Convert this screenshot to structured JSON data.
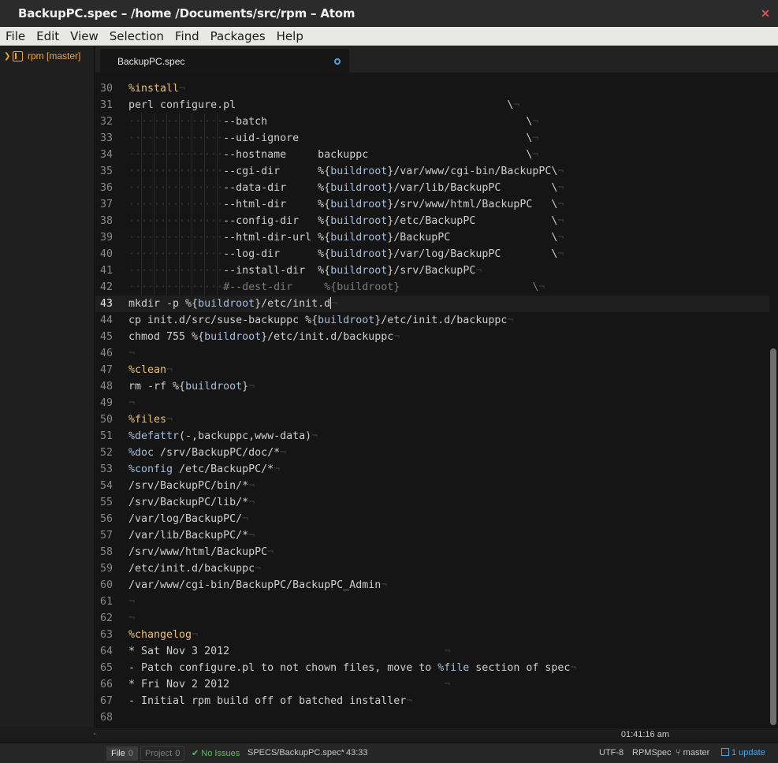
{
  "window": {
    "title": "BackupPC.spec – /home /Documents/src/rpm – Atom"
  },
  "menu": [
    "File",
    "Edit",
    "View",
    "Selection",
    "Find",
    "Packages",
    "Help"
  ],
  "tree": {
    "project_label": "rpm  [master]"
  },
  "tab": {
    "title": "BackupPC.spec"
  },
  "editor": {
    "cursor_line": 43,
    "lines": [
      {
        "n": "30",
        "tokens": [
          [
            "kw",
            "%install"
          ],
          [
            "eol",
            "¬"
          ]
        ]
      },
      {
        "n": "31",
        "tokens": [
          [
            "plain",
            "perl configure.pl                                           \\"
          ],
          [
            "eol",
            "¬"
          ]
        ]
      },
      {
        "n": "32",
        "tokens": [
          [
            "ws",
            "···············"
          ],
          [
            "plain",
            "--batch                                         \\"
          ],
          [
            "eol",
            "¬"
          ]
        ]
      },
      {
        "n": "33",
        "tokens": [
          [
            "ws",
            "···············"
          ],
          [
            "plain",
            "--uid-ignore                                    \\"
          ],
          [
            "eol",
            "¬"
          ]
        ]
      },
      {
        "n": "34",
        "tokens": [
          [
            "ws",
            "···············"
          ],
          [
            "plain",
            "--hostname     backuppc                         \\"
          ],
          [
            "eol",
            "¬"
          ]
        ]
      },
      {
        "n": "35",
        "tokens": [
          [
            "ws",
            "···············"
          ],
          [
            "plain",
            "--cgi-dir      %{"
          ],
          [
            "var",
            "buildroot"
          ],
          [
            "plain",
            "}/var/www/cgi-bin/BackupPC\\"
          ],
          [
            "eol",
            "¬"
          ]
        ]
      },
      {
        "n": "36",
        "tokens": [
          [
            "ws",
            "···············"
          ],
          [
            "plain",
            "--data-dir     %{"
          ],
          [
            "var",
            "buildroot"
          ],
          [
            "plain",
            "}/var/lib/BackupPC        \\"
          ],
          [
            "eol",
            "¬"
          ]
        ]
      },
      {
        "n": "37",
        "tokens": [
          [
            "ws",
            "···············"
          ],
          [
            "plain",
            "--html-dir     %{"
          ],
          [
            "var",
            "buildroot"
          ],
          [
            "plain",
            "}/srv/www/html/BackupPC   \\"
          ],
          [
            "eol",
            "¬"
          ]
        ]
      },
      {
        "n": "38",
        "tokens": [
          [
            "ws",
            "···············"
          ],
          [
            "plain",
            "--config-dir   %{"
          ],
          [
            "var",
            "buildroot"
          ],
          [
            "plain",
            "}/etc/BackupPC            \\"
          ],
          [
            "eol",
            "¬"
          ]
        ]
      },
      {
        "n": "39",
        "tokens": [
          [
            "ws",
            "···············"
          ],
          [
            "plain",
            "--html-dir-url %{"
          ],
          [
            "var",
            "buildroot"
          ],
          [
            "plain",
            "}/BackupPC                \\"
          ],
          [
            "eol",
            "¬"
          ]
        ]
      },
      {
        "n": "40",
        "tokens": [
          [
            "ws",
            "···············"
          ],
          [
            "plain",
            "--log-dir      %{"
          ],
          [
            "var",
            "buildroot"
          ],
          [
            "plain",
            "}/var/log/BackupPC        \\"
          ],
          [
            "eol",
            "¬"
          ]
        ]
      },
      {
        "n": "41",
        "tokens": [
          [
            "ws",
            "···············"
          ],
          [
            "plain",
            "--install-dir  %{"
          ],
          [
            "var",
            "buildroot"
          ],
          [
            "plain",
            "}/srv/BackupPC"
          ],
          [
            "eol",
            "¬"
          ]
        ]
      },
      {
        "n": "42",
        "tokens": [
          [
            "ws",
            "···············"
          ],
          [
            "com",
            "#--dest-dir     %{buildroot}                     \\"
          ],
          [
            "eol",
            "¬"
          ]
        ]
      },
      {
        "n": "43",
        "tokens": [
          [
            "plain",
            "mkdir -p %{"
          ],
          [
            "var",
            "buildroot"
          ],
          [
            "plain",
            "}/etc/init.d"
          ],
          [
            "cursor",
            ""
          ],
          [
            "eol",
            "¬"
          ]
        ]
      },
      {
        "n": "44",
        "tokens": [
          [
            "plain",
            "cp init.d/src/suse-backuppc %{"
          ],
          [
            "var",
            "buildroot"
          ],
          [
            "plain",
            "}/etc/init.d/backuppc"
          ],
          [
            "eol",
            "¬"
          ]
        ]
      },
      {
        "n": "45",
        "tokens": [
          [
            "plain",
            "chmod 755 %{"
          ],
          [
            "var",
            "buildroot"
          ],
          [
            "plain",
            "}/etc/init.d/backuppc"
          ],
          [
            "eol",
            "¬"
          ]
        ]
      },
      {
        "n": "46",
        "tokens": [
          [
            "eol",
            "¬"
          ]
        ]
      },
      {
        "n": "47",
        "tokens": [
          [
            "kw",
            "%clean"
          ],
          [
            "eol",
            "¬"
          ]
        ]
      },
      {
        "n": "48",
        "tokens": [
          [
            "plain",
            "rm -rf %{"
          ],
          [
            "var",
            "buildroot"
          ],
          [
            "plain",
            "}"
          ],
          [
            "eol",
            "¬"
          ]
        ]
      },
      {
        "n": "49",
        "tokens": [
          [
            "eol",
            "¬"
          ]
        ]
      },
      {
        "n": "50",
        "tokens": [
          [
            "kw",
            "%files"
          ],
          [
            "eol",
            "¬"
          ]
        ]
      },
      {
        "n": "51",
        "tokens": [
          [
            "var",
            "%defattr"
          ],
          [
            "plain",
            "(-,backuppc,www-data)"
          ],
          [
            "eol",
            "¬"
          ]
        ]
      },
      {
        "n": "52",
        "tokens": [
          [
            "var",
            "%doc"
          ],
          [
            "plain",
            " /srv/BackupPC/doc/*"
          ],
          [
            "eol",
            "¬"
          ]
        ]
      },
      {
        "n": "53",
        "tokens": [
          [
            "var",
            "%config"
          ],
          [
            "plain",
            " /etc/BackupPC/*"
          ],
          [
            "eol",
            "¬"
          ]
        ]
      },
      {
        "n": "54",
        "tokens": [
          [
            "plain",
            "/srv/BackupPC/bin/*"
          ],
          [
            "eol",
            "¬"
          ]
        ]
      },
      {
        "n": "55",
        "tokens": [
          [
            "plain",
            "/srv/BackupPC/lib/*"
          ],
          [
            "eol",
            "¬"
          ]
        ]
      },
      {
        "n": "56",
        "tokens": [
          [
            "plain",
            "/var/log/BackupPC/"
          ],
          [
            "eol",
            "¬"
          ]
        ]
      },
      {
        "n": "57",
        "tokens": [
          [
            "plain",
            "/var/lib/BackupPC/*"
          ],
          [
            "eol",
            "¬"
          ]
        ]
      },
      {
        "n": "58",
        "tokens": [
          [
            "plain",
            "/srv/www/html/BackupPC"
          ],
          [
            "eol",
            "¬"
          ]
        ]
      },
      {
        "n": "59",
        "tokens": [
          [
            "plain",
            "/etc/init.d/backuppc"
          ],
          [
            "eol",
            "¬"
          ]
        ]
      },
      {
        "n": "60",
        "tokens": [
          [
            "plain",
            "/var/www/cgi-bin/BackupPC/BackupPC_Admin"
          ],
          [
            "eol",
            "¬"
          ]
        ]
      },
      {
        "n": "61",
        "tokens": [
          [
            "eol",
            "¬"
          ]
        ]
      },
      {
        "n": "62",
        "tokens": [
          [
            "eol",
            "¬"
          ]
        ]
      },
      {
        "n": "63",
        "tokens": [
          [
            "kw",
            "%changelog"
          ],
          [
            "eol",
            "¬"
          ]
        ]
      },
      {
        "n": "64",
        "tokens": [
          [
            "plain",
            "* Sat Nov 3 2012                                  "
          ],
          [
            "eol",
            "¬"
          ]
        ]
      },
      {
        "n": "65",
        "tokens": [
          [
            "plain",
            "- Patch configure.pl to not chown files, move to "
          ],
          [
            "var",
            "%file"
          ],
          [
            "plain",
            " section of spec"
          ],
          [
            "eol",
            "¬"
          ]
        ]
      },
      {
        "n": "66",
        "tokens": [
          [
            "plain",
            "* Fri Nov 2 2012                                  "
          ],
          [
            "eol",
            "¬"
          ]
        ]
      },
      {
        "n": "67",
        "tokens": [
          [
            "plain",
            "- Initial rpm build off of batched installer"
          ],
          [
            "eol",
            "¬"
          ]
        ]
      },
      {
        "n": "68",
        "tokens": []
      }
    ]
  },
  "subbar": {
    "clock": "01:41:16 am"
  },
  "status": {
    "file_tab": "File",
    "file_count": "0",
    "project_tab": "Project",
    "project_count": "0",
    "issues": "No Issues",
    "path": "SPECS/BackupPC.spec*",
    "position": "43:33",
    "encoding": "UTF-8",
    "grammar": "RPMSpec",
    "branch": "master",
    "update": "1 update"
  },
  "colors": {
    "keyword": "#e8c07d",
    "variable": "#a7bddc",
    "accent": "#4aa3e6",
    "ok": "#5fbf5f"
  }
}
